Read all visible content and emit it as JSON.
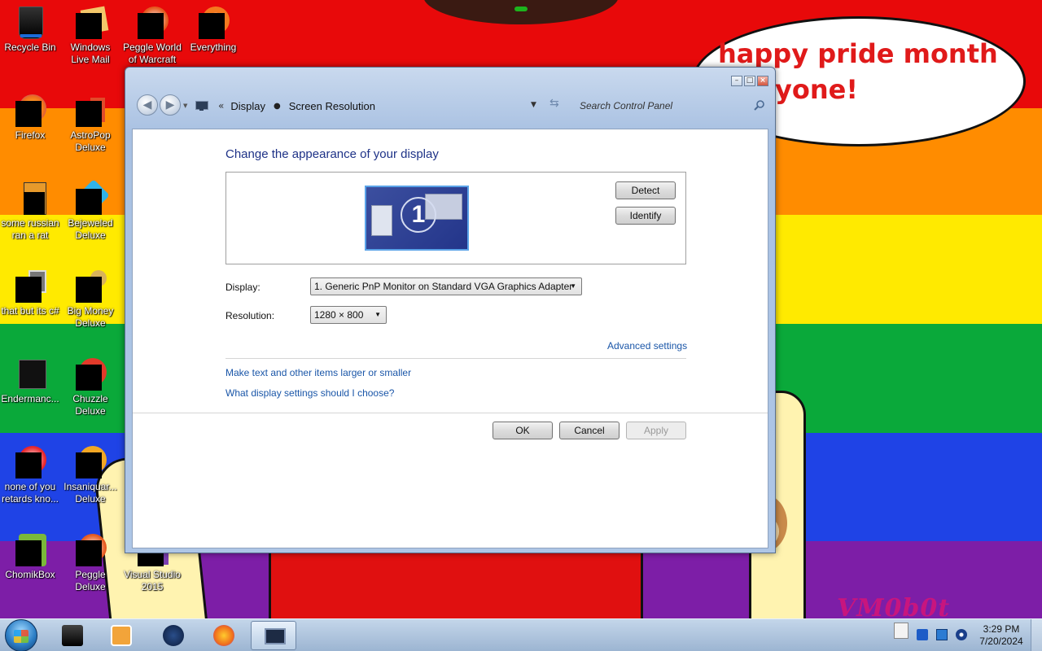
{
  "desktop": {
    "bubble_line1": "happy pride month",
    "bubble_line2": "yone!",
    "watermark": "VM0b0t",
    "icons": [
      {
        "label": "Recycle Bin"
      },
      {
        "label": "Windows Live Mail"
      },
      {
        "label": "Peggle World of Warcraft"
      },
      {
        "label": "Everything"
      },
      {
        "label": "Firefox"
      },
      {
        "label": "AstroPop Deluxe"
      },
      {
        "label": "some russian ran a rat"
      },
      {
        "label": "Bejeweled Deluxe"
      },
      {
        "label": "that but its c#"
      },
      {
        "label": "Big Money Deluxe"
      },
      {
        "label": "Endermanc..."
      },
      {
        "label": "Chuzzle Deluxe"
      },
      {
        "label": "none of you retards kno..."
      },
      {
        "label": "Insaniquar... Deluxe"
      },
      {
        "label": "ChomikBox"
      },
      {
        "label": "Peggle Deluxe"
      },
      {
        "label": "Visual Studio 2015"
      }
    ]
  },
  "window": {
    "breadcrumb": [
      "Display",
      "Screen Resolution"
    ],
    "search_placeholder": "Search Control Panel",
    "heading": "Change the appearance of your display",
    "monitor_number": "1",
    "detect_label": "Detect",
    "identify_label": "Identify",
    "display_label": "Display:",
    "display_value": "1. Generic PnP Monitor on Standard VGA Graphics Adapter",
    "resolution_label": "Resolution:",
    "resolution_value": "1280 × 800",
    "advanced_link": "Advanced settings",
    "link_text_size": "Make text and other items larger or smaller",
    "link_help": "What display settings should I choose?",
    "ok_label": "OK",
    "cancel_label": "Cancel",
    "apply_label": "Apply"
  },
  "taskbar": {
    "time": "3:29 PM",
    "date": "7/20/2024"
  },
  "colors": {
    "link": "#1a56a8",
    "heading": "#1e3287",
    "bubble_text": "#e01a1a"
  }
}
